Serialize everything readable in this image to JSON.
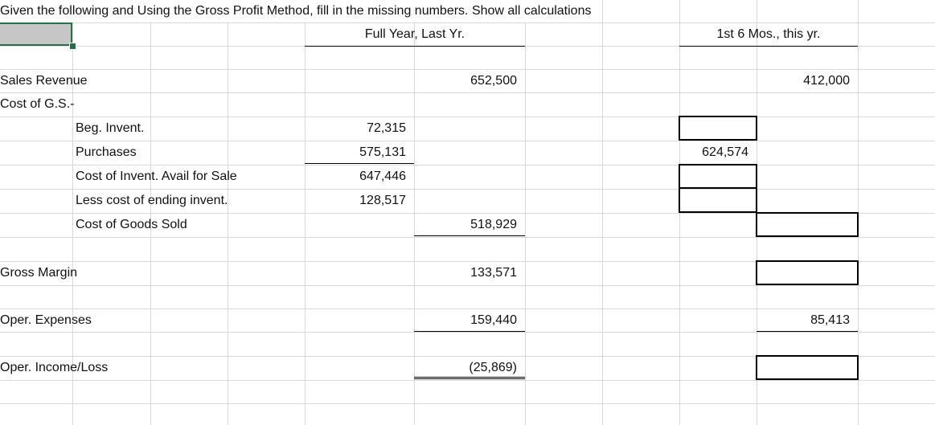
{
  "title": "Given the following and Using the Gross Profit Method, fill in the missing numbers. Show all calculations",
  "headers": {
    "full_year": "Full Year, Last Yr.",
    "six_months": "1st 6 Mos., this yr."
  },
  "rows": {
    "sales_revenue": {
      "label": "Sales Revenue",
      "full_year": "652,500",
      "six_months": "412,000"
    },
    "cost_gs": {
      "label": "Cost of G.S.-"
    },
    "beg_invent": {
      "label": "Beg. Invent.",
      "full_year": "72,315",
      "six_months": ""
    },
    "purchases": {
      "label": "Purchases",
      "full_year": "575,131",
      "six_months": "624,574"
    },
    "avail_for_sale": {
      "label": "Cost of Invent. Avail for Sale",
      "full_year": "647,446",
      "six_months": ""
    },
    "ending_invent": {
      "label": "Less cost of ending invent.",
      "full_year": "128,517",
      "six_months": ""
    },
    "cogs": {
      "label": "Cost of Goods Sold",
      "full_year": "518,929",
      "six_months": ""
    },
    "gross_margin": {
      "label": "Gross Margin",
      "full_year": "133,571",
      "six_months": ""
    },
    "oper_expenses": {
      "label": "Oper. Expenses",
      "full_year": "159,440",
      "six_months": "85,413"
    },
    "oper_income": {
      "label": "Oper. Income/Loss",
      "full_year": "(25,869)",
      "six_months": ""
    }
  },
  "colors": {
    "selection": "#217346",
    "selected_fill": "#c6c6c6",
    "gridline": "#d9d9d9"
  }
}
